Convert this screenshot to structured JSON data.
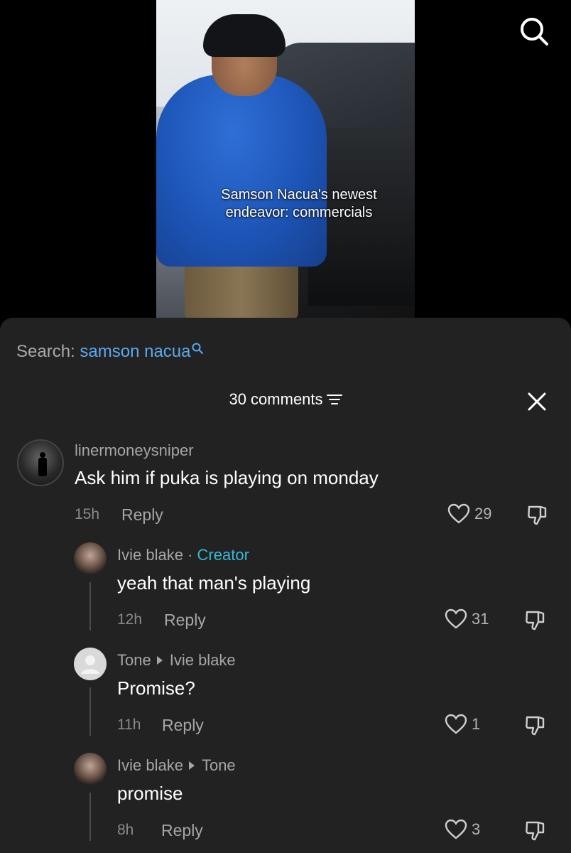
{
  "video": {
    "caption_line1": "Samson Nacua's newest",
    "caption_line2": "endeavor: commercials"
  },
  "search_suggestion": {
    "label": "Search:",
    "query": "samson nacua"
  },
  "comments_header": {
    "count_label": "30 comments"
  },
  "comments": [
    {
      "username": "linermoneysniper",
      "text": "Ask him if puka is playing on monday",
      "time": "15h",
      "reply_label": "Reply",
      "likes": "29"
    },
    {
      "username": "Ivie blake",
      "separator": "·",
      "badge": "Creator",
      "text": "yeah that man's playing",
      "time": "12h",
      "reply_label": "Reply",
      "likes": "31"
    },
    {
      "username": "Tone",
      "reply_to": "Ivie blake",
      "text": "Promise?",
      "time": "11h",
      "reply_label": "Reply",
      "likes": "1"
    },
    {
      "username": "Ivie blake",
      "reply_to": "Tone",
      "text": "promise",
      "time": "8h",
      "reply_label": "Reply",
      "likes": "3"
    }
  ],
  "colors": {
    "sheet_bg": "#222222",
    "link_blue": "#5aa9ee",
    "creator_badge": "#35b7d6"
  },
  "icons": [
    "search-icon",
    "filter-icon",
    "close-icon",
    "heart-icon",
    "dislike-icon",
    "default-avatar-icon"
  ]
}
